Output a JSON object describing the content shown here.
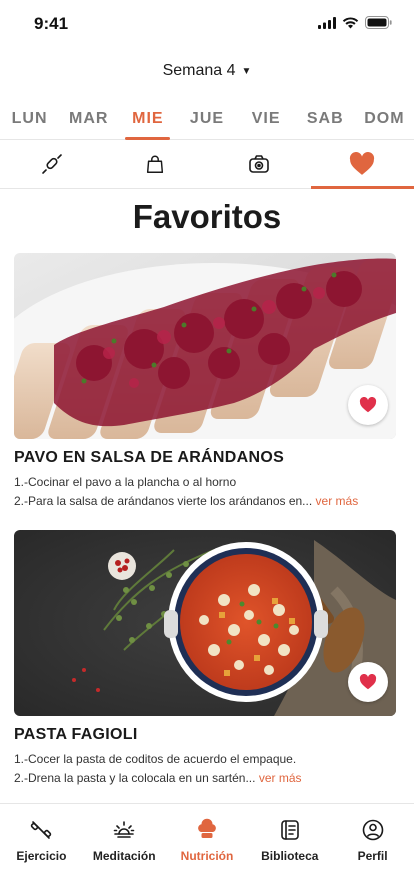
{
  "status": {
    "time": "9:41"
  },
  "week": {
    "label": "Semana 4"
  },
  "days": [
    "LUN",
    "MAR",
    "MIE",
    "JUE",
    "VIE",
    "SAB",
    "DOM"
  ],
  "active_day": "MIE",
  "categories": [
    {
      "icon": "rolling-pin-icon"
    },
    {
      "icon": "shopping-bag-icon"
    },
    {
      "icon": "camera-icon"
    },
    {
      "icon": "heart-icon",
      "active": true
    }
  ],
  "page_title": "Favoritos",
  "recipes": [
    {
      "title": "PAVO EN SALSA DE ARÁNDANOS",
      "step1": "1.-Cocinar el pavo a la plancha o al horno",
      "step2": "2.-Para la salsa de arándanos vierte los arándanos en...",
      "more": "ver más"
    },
    {
      "title": "PASTA FAGIOLI",
      "step1": "1.-Cocer la pasta de coditos de acuerdo el empaque.",
      "step2": "2.-Drena la pasta y la colocala en un sartén...",
      "more": "ver más"
    }
  ],
  "nav": [
    {
      "label": "Ejercicio",
      "icon": "dumbbell-icon"
    },
    {
      "label": "Meditación",
      "icon": "sunrise-icon"
    },
    {
      "label": "Nutrición",
      "icon": "chef-hat-icon",
      "active": true
    },
    {
      "label": "Biblioteca",
      "icon": "book-icon"
    },
    {
      "label": "Perfil",
      "icon": "profile-icon"
    }
  ],
  "colors": {
    "accent": "#e0663f",
    "text": "#1f1f1f",
    "muted": "#7a7a7a"
  }
}
